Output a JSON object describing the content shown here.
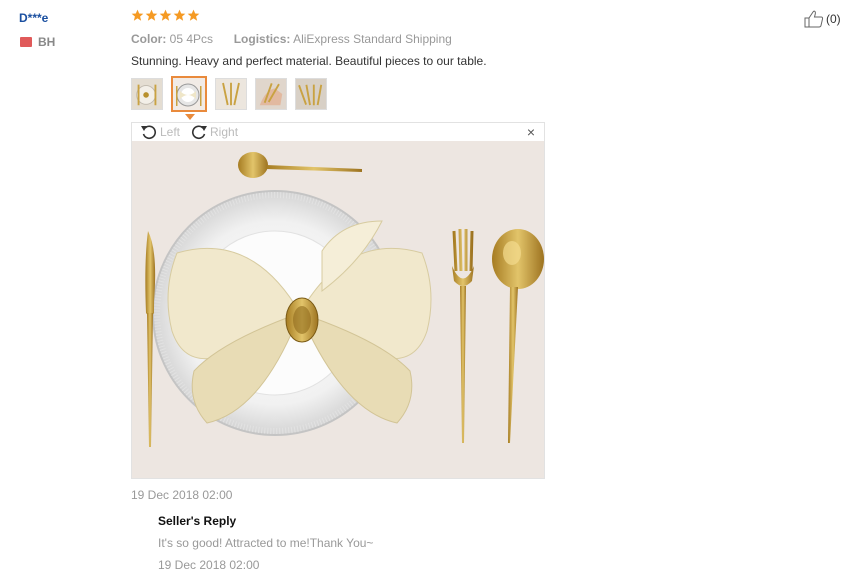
{
  "review": {
    "user_name": "D***e",
    "country_code": "BH",
    "rating": 5,
    "color_label": "Color:",
    "color_value": "05 4Pcs",
    "logistics_label": "Logistics:",
    "logistics_value": "AliExpress Standard Shipping",
    "text": "Stunning. Heavy and perfect material. Beautiful pieces to our table.",
    "helpful_count": "(0)",
    "date": "19 Dec 2018 02:00"
  },
  "viewer": {
    "rotate_left_label": "Left",
    "rotate_right_label": "Right",
    "close_label": "×",
    "thumbnail_count": 5,
    "active_thumbnail": 2
  },
  "seller_reply": {
    "title": "Seller's Reply",
    "text": "It's so good! Attracted to me!Thank You~",
    "date": "19 Dec 2018 02:00"
  },
  "colors": {
    "star": "#f59a23",
    "user_link": "#1a4fa0",
    "active_thumb_border": "#e98a3c",
    "gold": "#c9a242"
  }
}
